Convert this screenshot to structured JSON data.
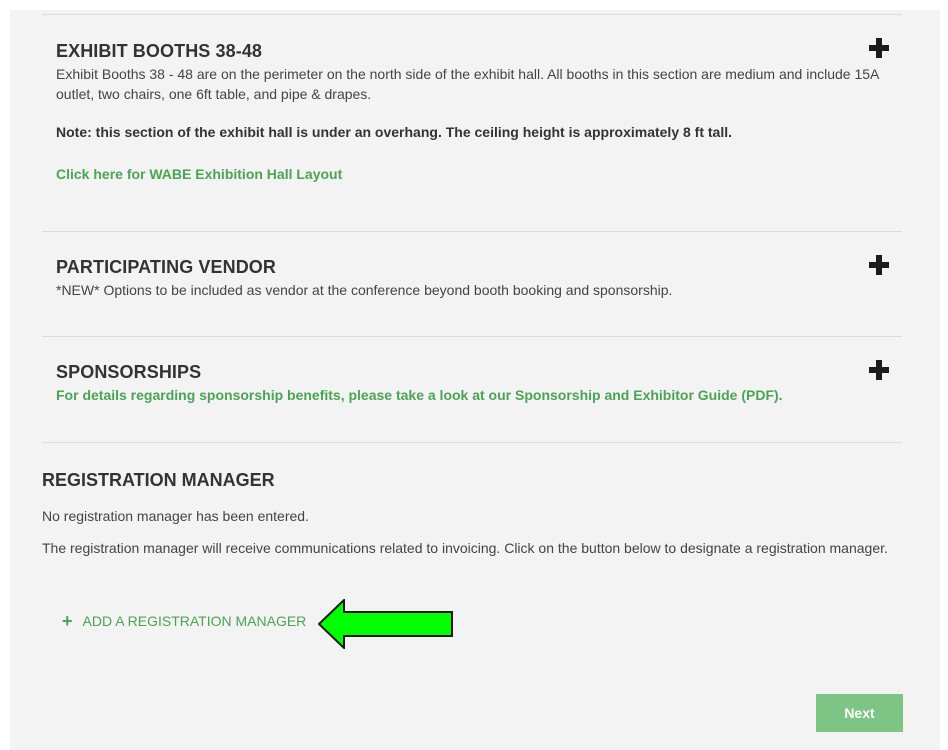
{
  "sections": {
    "exhibit": {
      "title": "EXHIBIT BOOTHS 38-48",
      "desc": "Exhibit Booths 38 - 48 are on the perimeter on the north side of the exhibit hall. All booths in this section are medium and include 15A outlet, two chairs, one 6ft table, and pipe & drapes.",
      "note": "Note: this section of the exhibit hall is under an overhang. The ceiling height is approximately 8 ft tall.",
      "link": "Click here for WABE Exhibition Hall Layout"
    },
    "vendor": {
      "title": "PARTICIPATING VENDOR",
      "desc": "*NEW* Options to be included as vendor at the conference beyond booth booking and sponsorship."
    },
    "sponsorships": {
      "title": "SPONSORSHIPS",
      "link": "For details regarding sponsorship benefits, please take a look at our Sponsorship and Exhibitor Guide (PDF)."
    }
  },
  "registration": {
    "title": "REGISTRATION MANAGER",
    "status": "No registration manager has been entered.",
    "info": "The registration manager will receive communications related to invoicing. Click on the button below to designate a registration manager.",
    "add_plus": "+",
    "add_label": "ADD A REGISTRATION MANAGER"
  },
  "next_label": "Next",
  "colors": {
    "green": "#4aa452",
    "next_button": "#7dc585",
    "annotation_arrow": "#00ff00"
  },
  "icons": {
    "expand": "plus-icon",
    "annotation": "arrow-left-icon"
  }
}
